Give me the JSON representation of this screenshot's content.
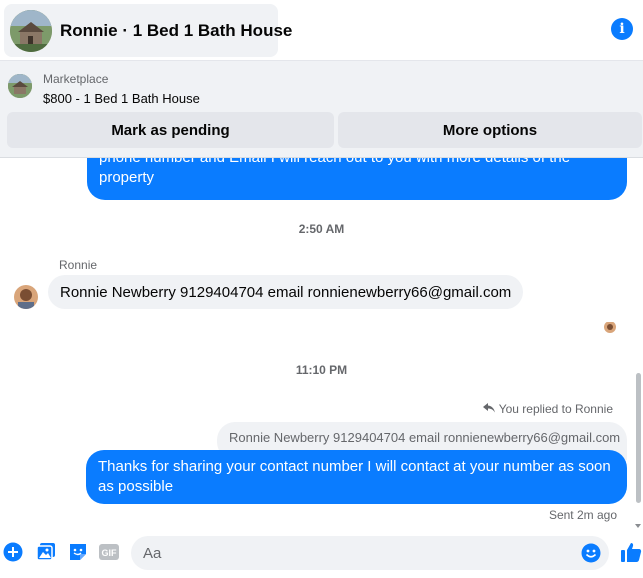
{
  "header": {
    "title": "Ronnie · 1 Bed 1 Bath House"
  },
  "marketplace": {
    "label": "Marketplace",
    "listing_title": "$800 - 1 Bed 1 Bath House",
    "pending_button": "Mark as pending",
    "more_button": "More options"
  },
  "thread": {
    "first_bubble_line1": "phone number and Email I will reach out to you with more details of the",
    "first_bubble_line2": "property",
    "time_1": "2:50 AM",
    "sender_name": "Ronnie",
    "incoming_message": "Ronnie Newberry 9129404704 email ronnienewberry66@gmail.com",
    "time_2": "11:10 PM",
    "replied_label": "You replied to Ronnie",
    "quoted_message": "Ronnie Newberry 9129404704 email ronnienewberry66@gmail.com",
    "last_bubble": "Thanks for sharing your contact number I will contact at your number as soon as possible",
    "sent_status": "Sent 2m ago"
  },
  "composer": {
    "placeholder": "Aa",
    "gif_label": "GIF"
  },
  "colors": {
    "accent": "#0a7cff",
    "bubble_in": "#f0f2f5",
    "muted_text": "#65676b"
  }
}
